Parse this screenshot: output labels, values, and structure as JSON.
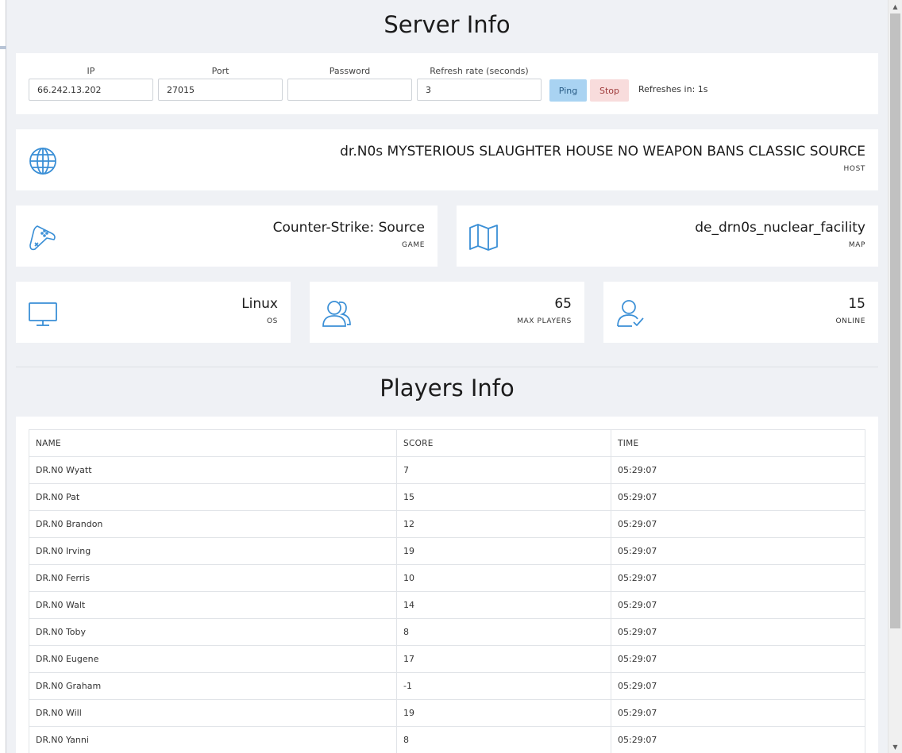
{
  "server": {
    "title": "Server Info",
    "form": {
      "ip_label": "IP",
      "ip_value": "66.242.13.202",
      "port_label": "Port",
      "port_value": "27015",
      "password_label": "Password",
      "password_value": "",
      "refresh_label": "Refresh rate (seconds)",
      "refresh_value": "3",
      "ping_label": "Ping",
      "stop_label": "Stop",
      "refresh_status": "Refreshes in: 1s"
    },
    "host": {
      "value": "dr.N0s MYSTERIOUS SLAUGHTER HOUSE NO WEAPON BANS CLASSIC SOURCE",
      "label": "HOST",
      "icon": "globe-icon"
    },
    "game": {
      "value": "Counter-Strike: Source",
      "label": "GAME",
      "icon": "gamepad-icon"
    },
    "map": {
      "value": "de_drn0s_nuclear_facility",
      "label": "MAP",
      "icon": "map-icon"
    },
    "os": {
      "value": "Linux",
      "label": "OS",
      "icon": "monitor-icon"
    },
    "max_players": {
      "value": "65",
      "label": "MAX PLAYERS",
      "icon": "users-icon"
    },
    "online": {
      "value": "15",
      "label": "ONLINE",
      "icon": "user-check-icon"
    }
  },
  "players": {
    "title": "Players Info",
    "columns": [
      "NAME",
      "SCORE",
      "TIME"
    ],
    "rows": [
      [
        "DR.N0 Wyatt",
        "7",
        "05:29:07"
      ],
      [
        "DR.N0 Pat",
        "15",
        "05:29:07"
      ],
      [
        "DR.N0 Brandon",
        "12",
        "05:29:07"
      ],
      [
        "DR.N0 Irving",
        "19",
        "05:29:07"
      ],
      [
        "DR.N0 Ferris",
        "10",
        "05:29:07"
      ],
      [
        "DR.N0 Walt",
        "14",
        "05:29:07"
      ],
      [
        "DR.N0 Toby",
        "8",
        "05:29:07"
      ],
      [
        "DR.N0 Eugene",
        "17",
        "05:29:07"
      ],
      [
        "DR.N0 Graham",
        "-1",
        "05:29:07"
      ],
      [
        "DR.N0 Will",
        "19",
        "05:29:07"
      ],
      [
        "DR.N0 Yanni",
        "8",
        "05:29:07"
      ]
    ]
  },
  "colors": {
    "accent": "#3a8fd6",
    "background": "#eff1f5",
    "ping_button": "#a9d3f2",
    "stop_button": "#f8dcdc"
  }
}
